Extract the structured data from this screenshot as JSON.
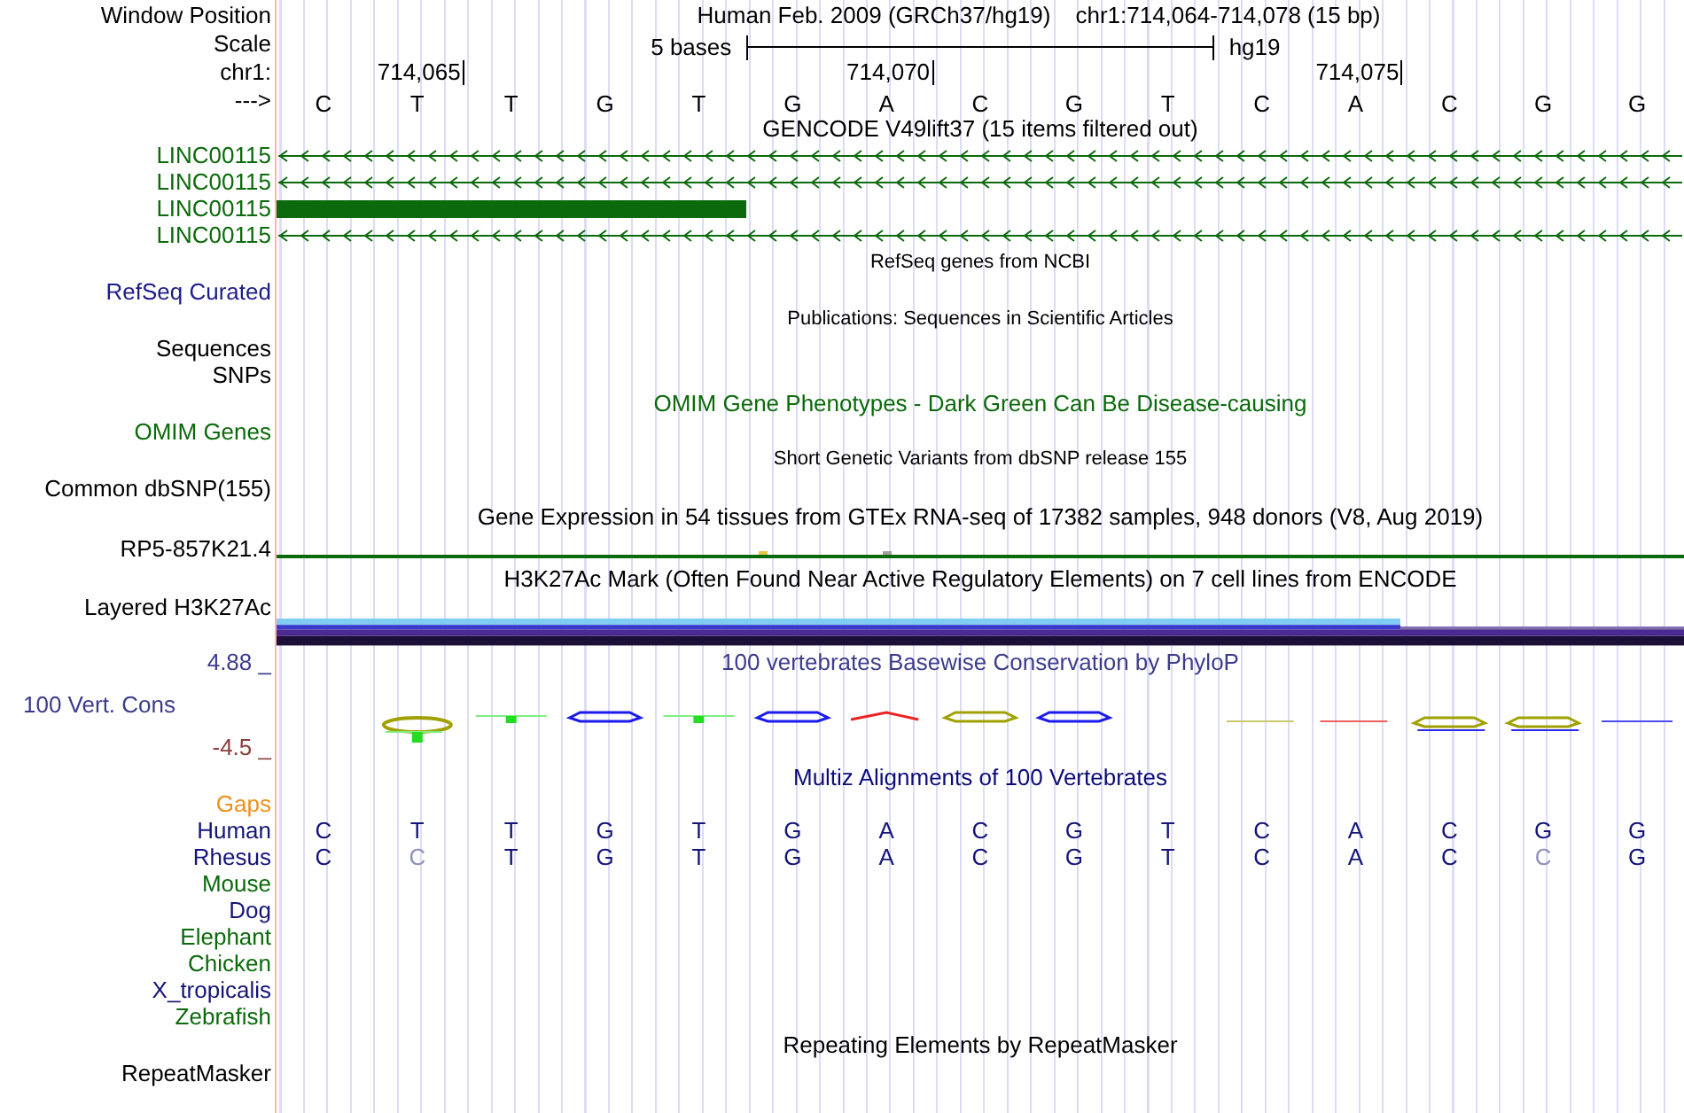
{
  "header": {
    "labels": [
      {
        "text": "Window Position"
      },
      {
        "text": "Scale"
      },
      {
        "text": "chr1:"
      },
      {
        "text": "--->"
      }
    ],
    "assembly": "Human Feb. 2009 (GRCh37/hg19)",
    "position": "chr1:714,064-714,078 (15 bp)",
    "scale_text": "5 bases",
    "genome": "hg19",
    "ticks": [
      "714,065",
      "714,070",
      "714,075"
    ],
    "bases": [
      "C",
      "T",
      "T",
      "G",
      "T",
      "G",
      "A",
      "C",
      "G",
      "T",
      "C",
      "A",
      "C",
      "G",
      "G"
    ]
  },
  "tracks": [
    {
      "kind": "gencode",
      "title": {
        "text": "GENCODE V49lift37 (15 items filtered out)",
        "color": "#000000"
      },
      "items": [
        {
          "label": "LINC00115",
          "color": "#0b6a0b",
          "kind": "arrows"
        },
        {
          "label": "LINC00115",
          "color": "#0b6a0b",
          "kind": "arrows"
        },
        {
          "label": "LINC00115",
          "color": "#0b6a0b",
          "kind": "block"
        },
        {
          "label": "LINC00115",
          "color": "#0b6a0b",
          "kind": "arrows"
        }
      ]
    },
    {
      "kind": "compact",
      "title": {
        "text": "RefSeq genes from NCBI",
        "color": "#000000"
      },
      "labels": [
        {
          "text": "RefSeq Curated",
          "color": "#1c1c8a"
        }
      ]
    },
    {
      "kind": "compact",
      "title": {
        "text": "Publications: Sequences in Scientific Articles",
        "color": "#000000"
      },
      "labels": [
        {
          "text": "Sequences",
          "color": "#000000"
        },
        {
          "text": "SNPs",
          "color": "#000000"
        }
      ]
    },
    {
      "kind": "full",
      "title": {
        "text": "OMIM Gene Phenotypes - Dark Green Can Be Disease-causing",
        "color": "#0b6a0b"
      },
      "labels": [
        {
          "text": "OMIM Genes",
          "color": "#0b6a0b"
        }
      ]
    },
    {
      "kind": "compact",
      "title": {
        "text": "Short Genetic Variants from dbSNP release 155",
        "color": "#000000"
      },
      "labels": [
        {
          "text": "Common dbSNP(155)",
          "color": "#000000"
        }
      ]
    },
    {
      "kind": "expression",
      "title": {
        "text": "Gene Expression in 54 tissues from GTEx RNA-seq of 17382 samples, 948 donors (V8, Aug 2019)",
        "color": "#000000"
      },
      "labels": [
        {
          "text": "RP5-857K21.4",
          "color": "#000000"
        }
      ]
    },
    {
      "kind": "signal",
      "title": {
        "text": "H3K27Ac Mark (Often Found Near Active Regulatory Elements) on 7 cell lines from ENCODE",
        "color": "#000000"
      },
      "labels": [
        {
          "text": "Layered H3K27Ac",
          "color": "#000000"
        }
      ]
    },
    {
      "kind": "conservation",
      "title": {
        "text": "100 vertebrates Basewise Conservation by PhyloP",
        "color": "#3c3c8c"
      },
      "max": {
        "text": "4.88 _",
        "color": "#3c3c8c"
      },
      "label": {
        "text": "100 Vert. Cons",
        "color": "#3c3c8c"
      },
      "min": {
        "text": "-4.5 _",
        "color": "#8c3c3c"
      }
    },
    {
      "kind": "alignment",
      "title": {
        "text": "Multiz Alignments of 100 Vertebrates",
        "color": "#0c0c78"
      },
      "species": [
        {
          "name": "Gaps",
          "color": "#f0901a"
        },
        {
          "name": "Human",
          "color": "#141478",
          "bases": [
            {
              "base": "C",
              "faded": false
            },
            {
              "base": "T",
              "faded": false
            },
            {
              "base": "T",
              "faded": false
            },
            {
              "base": "G",
              "faded": false
            },
            {
              "base": "T",
              "faded": false
            },
            {
              "base": "G",
              "faded": false
            },
            {
              "base": "A",
              "faded": false
            },
            {
              "base": "C",
              "faded": false
            },
            {
              "base": "G",
              "faded": false
            },
            {
              "base": "T",
              "faded": false
            },
            {
              "base": "C",
              "faded": false
            },
            {
              "base": "A",
              "faded": false
            },
            {
              "base": "C",
              "faded": false
            },
            {
              "base": "G",
              "faded": false
            },
            {
              "base": "G",
              "faded": false
            }
          ]
        },
        {
          "name": "Rhesus",
          "color": "#141478",
          "bases": [
            {
              "base": "C",
              "faded": false
            },
            {
              "base": "C",
              "faded": true
            },
            {
              "base": "T",
              "faded": false
            },
            {
              "base": "G",
              "faded": false
            },
            {
              "base": "T",
              "faded": false
            },
            {
              "base": "G",
              "faded": false
            },
            {
              "base": "A",
              "faded": false
            },
            {
              "base": "C",
              "faded": false
            },
            {
              "base": "G",
              "faded": false
            },
            {
              "base": "T",
              "faded": false
            },
            {
              "base": "C",
              "faded": false
            },
            {
              "base": "A",
              "faded": false
            },
            {
              "base": "C",
              "faded": false
            },
            {
              "base": "C",
              "faded": true
            },
            {
              "base": "G",
              "faded": false
            }
          ]
        },
        {
          "name": "Mouse",
          "color": "#0b6a0b"
        },
        {
          "name": "Dog",
          "color": "#141478"
        },
        {
          "name": "Elephant",
          "color": "#0b6a0b"
        },
        {
          "name": "Chicken",
          "color": "#0b6a0b"
        },
        {
          "name": "X_tropicalis",
          "color": "#141478"
        },
        {
          "name": "Zebrafish",
          "color": "#0b6a0b"
        }
      ]
    },
    {
      "kind": "full",
      "title": {
        "text": "Repeating Elements by RepeatMasker",
        "color": "#000000"
      },
      "labels": [
        {
          "text": "RepeatMasker",
          "color": "#000000"
        }
      ]
    }
  ]
}
